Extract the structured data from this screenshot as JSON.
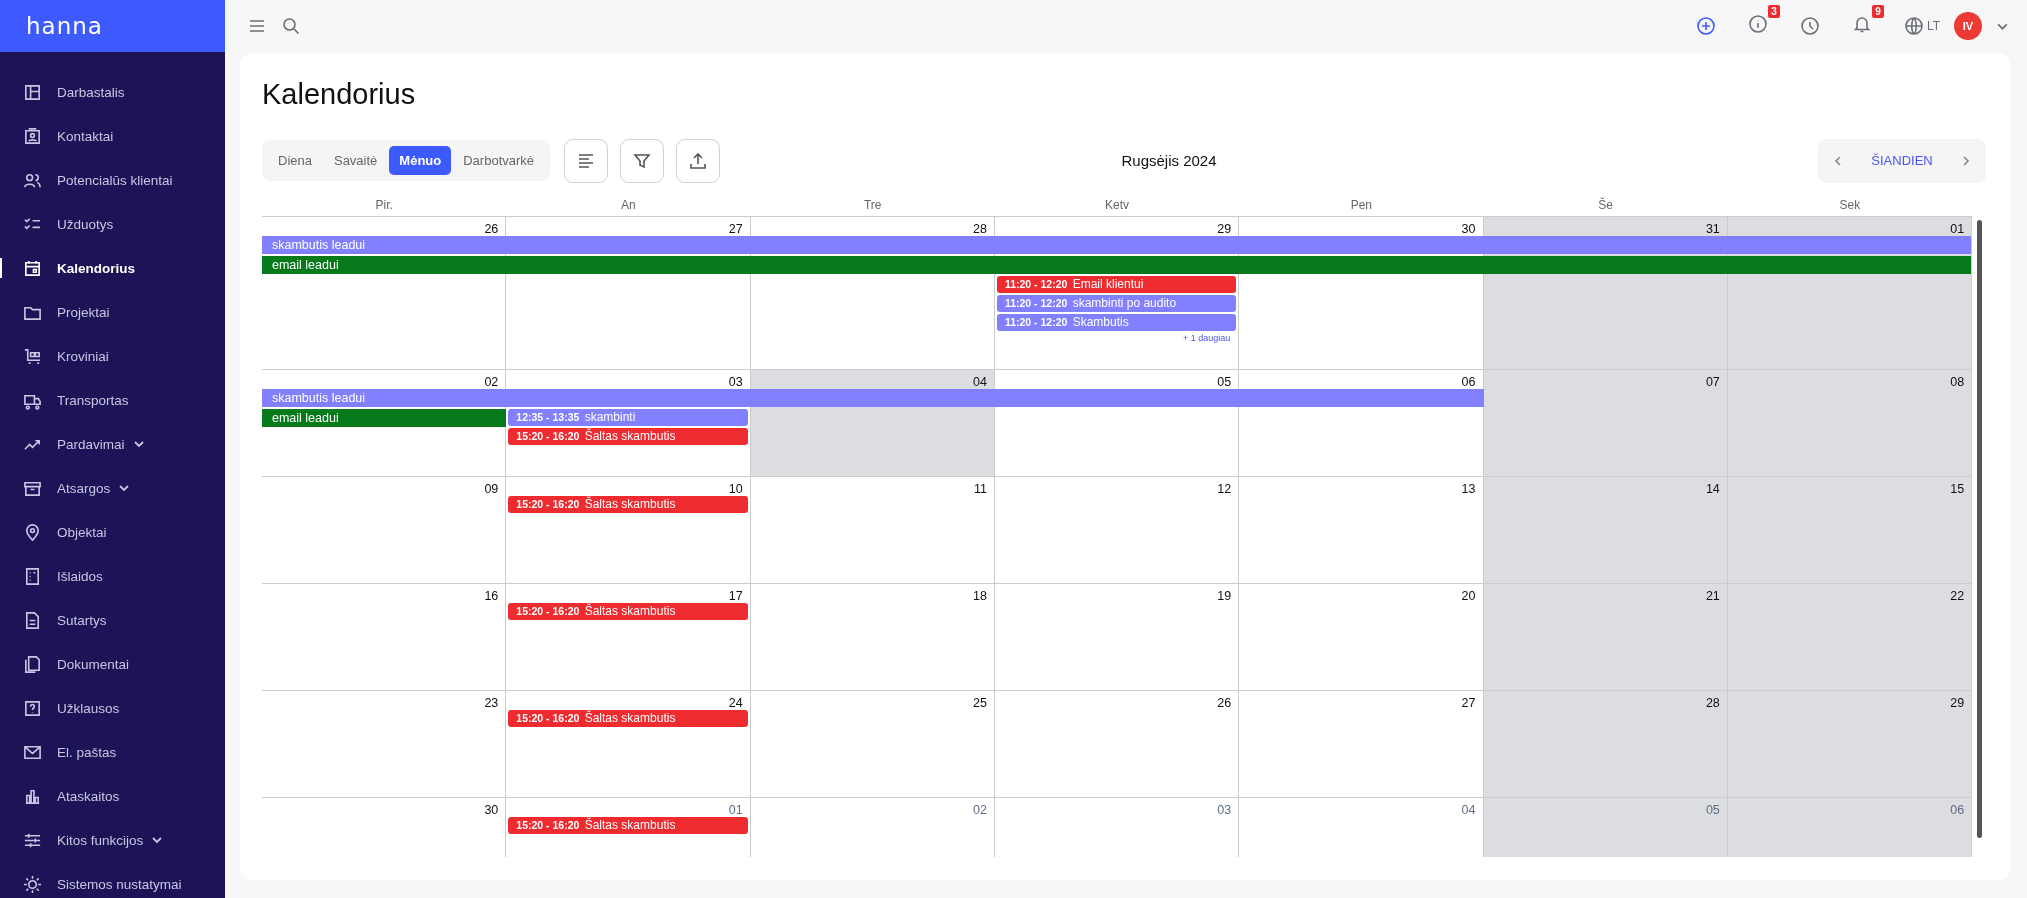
{
  "sidebar": {
    "logo": "hanna",
    "items": [
      {
        "label": "Darbastalis",
        "selected": false
      },
      {
        "label": "Kontaktai",
        "selected": false
      },
      {
        "label": "Potencialūs klientai",
        "selected": false
      },
      {
        "label": "Užduotys",
        "selected": false
      },
      {
        "label": "Kalendorius",
        "selected": true
      },
      {
        "label": "Projektai",
        "selected": false
      },
      {
        "label": "Kroviniai",
        "selected": false
      },
      {
        "label": "Transportas",
        "selected": false
      },
      {
        "label": "Pardavimai",
        "selected": false,
        "expanded": false
      },
      {
        "label": "Atsargos",
        "selected": false,
        "expanded": false
      },
      {
        "label": "Objektai",
        "selected": false
      },
      {
        "label": "Išlaidos",
        "selected": false
      },
      {
        "label": "Sutartys",
        "selected": false
      },
      {
        "label": "Dokumentai",
        "selected": false
      },
      {
        "label": "Užklausos",
        "selected": false
      },
      {
        "label": "El. paštas",
        "selected": false
      },
      {
        "label": "Ataskaitos",
        "selected": false
      },
      {
        "label": "Kitos funkcijos",
        "selected": false,
        "expanded": false
      },
      {
        "label": "Sistemos nustatymai",
        "selected": false
      }
    ]
  },
  "topbar": {
    "info_badge": "3",
    "notifications_badge": "9",
    "language": "LT",
    "avatar": "IV"
  },
  "page": {
    "title": "Kalendorius"
  },
  "views": [
    {
      "label": "Diena",
      "selected": false
    },
    {
      "label": "Savaitė",
      "selected": false
    },
    {
      "label": "Mėnuo",
      "selected": true
    },
    {
      "label": "Darbotvarkė",
      "selected": false
    }
  ],
  "month": "Rugsėjis 2024",
  "today_button": "ŠIANDIEN",
  "weekdays": [
    "Pir.",
    "An",
    "Tre",
    "Ketv",
    "Pen",
    "Še",
    "Sek"
  ],
  "weeks": [
    {
      "days": [
        {
          "date": "26",
          "shaded": false,
          "muted": false,
          "all_day": [
            {
              "title": "skambutis leadui",
              "color": "#8280ff"
            },
            {
              "title": "email leadui",
              "color": "#067a1a"
            }
          ]
        },
        {
          "date": "27",
          "shaded": false,
          "muted": false,
          "all_day": [
            {
              "color": "#8280ff"
            },
            {
              "color": "#067a1a"
            }
          ]
        },
        {
          "date": "28",
          "shaded": false,
          "muted": false,
          "all_day": [
            {
              "color": "#8280ff"
            },
            {
              "color": "#067a1a"
            }
          ]
        },
        {
          "date": "29",
          "shaded": false,
          "muted": false,
          "all_day": [
            {
              "color": "#8280ff"
            },
            {
              "color": "#067a1a"
            }
          ],
          "events": [
            {
              "time": "11:20 - 12:20",
              "title": "Email klientui",
              "color": "#ee2b2f"
            },
            {
              "time": "11:20 - 12:20",
              "title": "skambinti po audito",
              "color": "#8280ff"
            },
            {
              "time": "11:20 - 12:20",
              "title": "Skambutis",
              "color": "#8280ff"
            }
          ],
          "more": "+ 1 daugiau"
        },
        {
          "date": "30",
          "shaded": false,
          "muted": false,
          "all_day": [
            {
              "color": "#8280ff"
            },
            {
              "color": "#067a1a"
            }
          ]
        },
        {
          "date": "31",
          "shaded": true,
          "muted": false,
          "all_day": [
            {
              "color": "#8280ff"
            },
            {
              "color": "#067a1a"
            }
          ]
        },
        {
          "date": "01",
          "shaded": true,
          "muted": false,
          "all_day": [
            {
              "color": "#8280ff"
            },
            {
              "color": "#067a1a"
            }
          ]
        }
      ]
    },
    {
      "days": [
        {
          "date": "02",
          "shaded": false,
          "muted": false,
          "all_day": [
            {
              "title": "skambutis leadui",
              "color": "#8280ff"
            },
            {
              "title": "email leadui",
              "color": "#067a1a"
            }
          ]
        },
        {
          "date": "03",
          "shaded": false,
          "muted": false,
          "all_day": [
            {
              "color": "#8280ff"
            }
          ],
          "events": [
            {
              "time": "12:35 - 13:35",
              "title": "skambinti",
              "color": "#8280ff"
            },
            {
              "time": "15:20 - 16:20",
              "title": "Šaltas skambutis",
              "color": "#ee2b2f"
            }
          ]
        },
        {
          "date": "04",
          "shaded": true,
          "muted": false,
          "all_day": [
            {
              "color": "#8280ff"
            }
          ]
        },
        {
          "date": "05",
          "shaded": false,
          "muted": false,
          "all_day": [
            {
              "color": "#8280ff"
            }
          ]
        },
        {
          "date": "06",
          "shaded": false,
          "muted": false,
          "all_day": [
            {
              "color": "#8280ff"
            }
          ]
        },
        {
          "date": "07",
          "shaded": true,
          "muted": false
        },
        {
          "date": "08",
          "shaded": true,
          "muted": false
        }
      ]
    },
    {
      "days": [
        {
          "date": "09",
          "shaded": false,
          "muted": false
        },
        {
          "date": "10",
          "shaded": false,
          "muted": false,
          "events": [
            {
              "time": "15:20 - 16:20",
              "title": "Šaltas skambutis",
              "color": "#ee2b2f"
            }
          ]
        },
        {
          "date": "11",
          "shaded": false,
          "muted": false
        },
        {
          "date": "12",
          "shaded": false,
          "muted": false
        },
        {
          "date": "13",
          "shaded": false,
          "muted": false
        },
        {
          "date": "14",
          "shaded": true,
          "muted": false
        },
        {
          "date": "15",
          "shaded": true,
          "muted": false
        }
      ]
    },
    {
      "days": [
        {
          "date": "16",
          "shaded": false,
          "muted": false
        },
        {
          "date": "17",
          "shaded": false,
          "muted": false,
          "events": [
            {
              "time": "15:20 - 16:20",
              "title": "Šaltas skambutis",
              "color": "#ee2b2f"
            }
          ]
        },
        {
          "date": "18",
          "shaded": false,
          "muted": false
        },
        {
          "date": "19",
          "shaded": false,
          "muted": false
        },
        {
          "date": "20",
          "shaded": false,
          "muted": false
        },
        {
          "date": "21",
          "shaded": true,
          "muted": false
        },
        {
          "date": "22",
          "shaded": true,
          "muted": false
        }
      ]
    },
    {
      "days": [
        {
          "date": "23",
          "shaded": false,
          "muted": false
        },
        {
          "date": "24",
          "shaded": false,
          "muted": false,
          "events": [
            {
              "time": "15:20 - 16:20",
              "title": "Šaltas skambutis",
              "color": "#ee2b2f"
            }
          ]
        },
        {
          "date": "25",
          "shaded": false,
          "muted": false
        },
        {
          "date": "26",
          "shaded": false,
          "muted": false
        },
        {
          "date": "27",
          "shaded": false,
          "muted": false
        },
        {
          "date": "28",
          "shaded": true,
          "muted": false
        },
        {
          "date": "29",
          "shaded": true,
          "muted": false
        }
      ]
    },
    {
      "days": [
        {
          "date": "30",
          "shaded": false,
          "muted": false
        },
        {
          "date": "01",
          "shaded": false,
          "muted": true,
          "events": [
            {
              "time": "15:20 - 16:20",
              "title": "Šaltas skambutis",
              "color": "#ee2b2f"
            }
          ]
        },
        {
          "date": "02",
          "shaded": false,
          "muted": true
        },
        {
          "date": "03",
          "shaded": false,
          "muted": true
        },
        {
          "date": "04",
          "shaded": false,
          "muted": true
        },
        {
          "date": "05",
          "shaded": true,
          "muted": true
        },
        {
          "date": "06",
          "shaded": true,
          "muted": true
        }
      ]
    }
  ]
}
